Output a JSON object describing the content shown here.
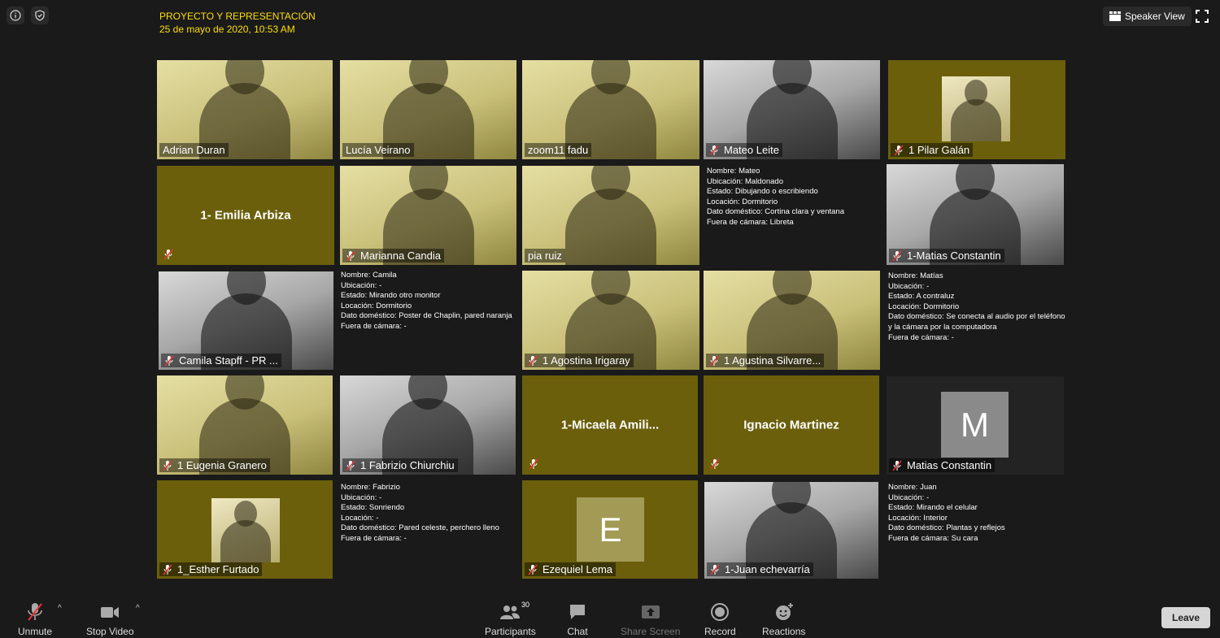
{
  "header": {
    "meeting_title": "PROYECTO Y REPRESENTACIÓN",
    "meeting_date": "25 de mayo de 2020, 10:53 AM",
    "speaker_view_label": "Speaker View"
  },
  "participants": {
    "adrian": "Adrian Duran",
    "lucia": "Lucía Veirano",
    "zoom11": "zoom11 fadu",
    "mateo": "Mateo Leite",
    "pilar": "1 Pilar Galán",
    "emilia": "1- Emilia Arbiza",
    "marianna": "Marianna Candia",
    "pia": "pia ruiz",
    "matias1": "1-Matias Constantin",
    "camila": "Camila Stapff - PR ...",
    "agostina": "1 Agostina Irigaray",
    "agustina": "1 Agustina Silvarre...",
    "eugenia": "1 Eugenia Granero",
    "fabrizio": "1 Fabrizio Chiurchiu",
    "micaela": "1-Micaela  Amili...",
    "ignacio": "Ignacio Martinez",
    "matias2": "Matias Constantin",
    "matias2_initial": "M",
    "esther": "1_Esther Furtado",
    "ezequiel": "Ezequiel Lema",
    "ezequiel_initial": "E",
    "juan": "1-Juan echevarría"
  },
  "notes": {
    "mateo": [
      "Nombre: Mateo",
      "Ubicación: Maldonado",
      "Estado: Dibujando o escribiendo",
      "Locación: Dormitorio",
      "Dato doméstico: Cortina clara y ventana",
      "Fuera de cámara: Libreta"
    ],
    "camila": [
      "Nombre: Camila",
      "Ubicación: -",
      "Estado: Mirando otro monitor",
      "Locación: Dormitorio",
      "Dato doméstico: Poster de Chaplin, pared naranja",
      "Fuera de cámara: -"
    ],
    "matias": [
      "Nombre: Matías",
      "Ubicación: -",
      "Estado: A contraluz",
      "Locación: Dormitorio",
      "Dato doméstico: Se conecta al audio por el teléfono",
      "y la cámara por la computadora",
      "Fuera de cámara: -"
    ],
    "fabrizio": [
      "Nombre: Fabrizio",
      "Ubicación: -",
      "Estado: Sonriendo",
      "Locación: -",
      "Dato doméstico: Pared celeste, perchero lleno",
      "Fuera de cámara: -"
    ],
    "juan": [
      "Nombre: Juan",
      "Ubicación: -",
      "Estado: Mirando el celular",
      "Locación: Interior",
      "Dato doméstico: Plantas y reflejos",
      "Fuera de cámara: Su cara"
    ]
  },
  "toolbar": {
    "unmute": "Unmute",
    "stop_video": "Stop Video",
    "participants": "Participants",
    "participants_count": "30",
    "chat": "Chat",
    "share_screen": "Share Screen",
    "record": "Record",
    "reactions": "Reactions",
    "leave": "Leave"
  },
  "colors": {
    "title_yellow": "#ffdf00",
    "tile_olive": "#6b5f0b",
    "background": "#1a1a1a"
  }
}
